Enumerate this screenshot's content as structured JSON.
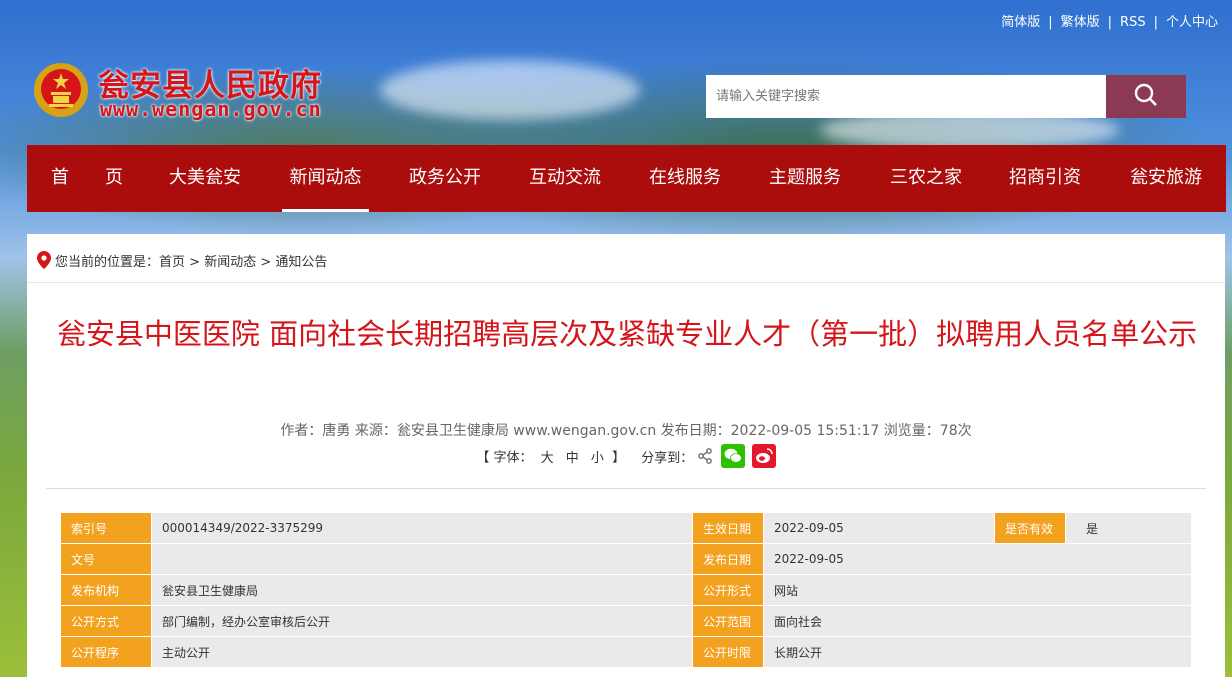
{
  "top_links": [
    "简体版",
    "繁体版",
    "RSS",
    "个人中心"
  ],
  "site": {
    "title": "瓮安县人民政府",
    "url": "www.wengan.gov.cn"
  },
  "search": {
    "placeholder": "请输入关键字搜索"
  },
  "nav": {
    "items": [
      {
        "label": "首　　页"
      },
      {
        "label": "大美瓮安"
      },
      {
        "label": "新闻动态"
      },
      {
        "label": "政务公开"
      },
      {
        "label": "互动交流"
      },
      {
        "label": "在线服务"
      },
      {
        "label": "主题服务"
      },
      {
        "label": "三农之家"
      },
      {
        "label": "招商引资"
      },
      {
        "label": "瓮安旅游"
      }
    ],
    "active_index": 2
  },
  "breadcrumb": {
    "prefix": "您当前的位置是：",
    "items": [
      "首页",
      "新闻动态",
      "通知公告"
    ],
    "sep": ">"
  },
  "article": {
    "title": "瓮安县中医医院 面向社会长期招聘高层次及紧缺专业人才（第一批）拟聘用人员名单公示",
    "meta": "作者：唐勇 来源：瓮安县卫生健康局 www.wengan.gov.cn 发布日期：2022-09-05 15:51:17 浏览量：78次",
    "font_label": "【 字体：",
    "font_sizes": [
      "大",
      "中",
      "小"
    ],
    "font_close": "】",
    "share_label": "分享到："
  },
  "info_table": {
    "rows": [
      [
        "索引号",
        "000014349/2022-3375299",
        "生效日期",
        "2022-09-05",
        "是否有效",
        "是"
      ],
      [
        "文号",
        "",
        "发布日期",
        "2022-09-05"
      ],
      [
        "发布机构",
        "瓮安县卫生健康局",
        "公开形式",
        "网站"
      ],
      [
        "公开方式",
        "部门编制，经办公室审核后公开",
        "公开范围",
        "面向社会"
      ],
      [
        "公开程序",
        "主动公开",
        "公开时限",
        "长期公开"
      ]
    ]
  },
  "colors": {
    "brand_red": "#d4161b",
    "nav_bg": "#ab0c0c",
    "search_btn": "#8c3a54",
    "label_bg": "#f3a21f",
    "value_bg": "#eaeaea",
    "wechat": "#2dc100",
    "weibo": "#e6162d"
  }
}
